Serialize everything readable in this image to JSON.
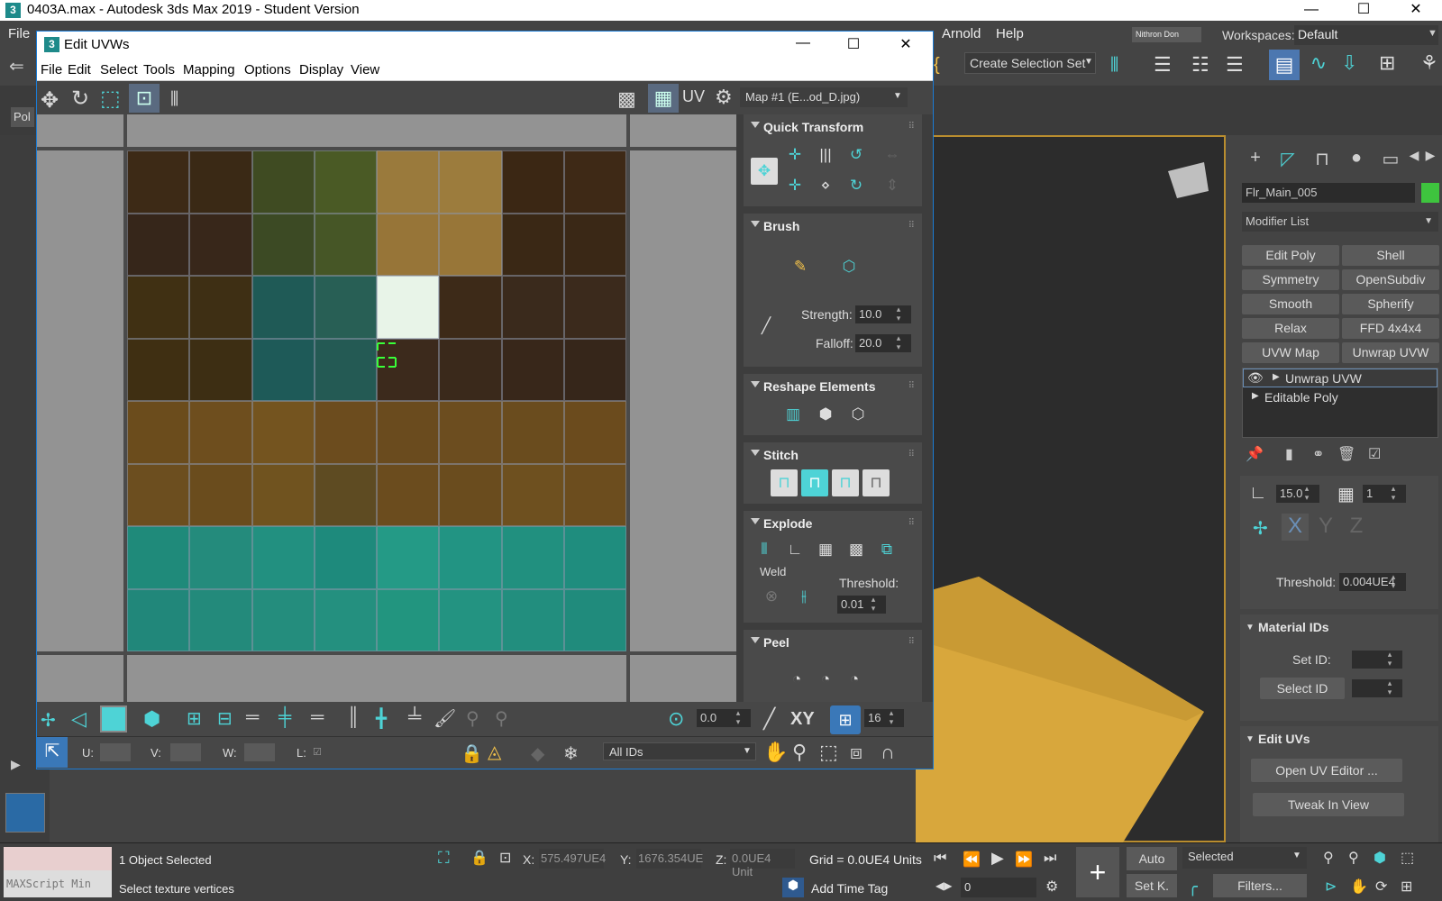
{
  "app": {
    "title": "0403A.max - Autodesk 3ds Max 2019 - Student Version",
    "logo": "3"
  },
  "main_menu": {
    "file": "File",
    "arnold": "Arnold",
    "help": "Help",
    "user": "Nithron Don",
    "workspaces_label": "Workspaces:",
    "workspace_value": "Default",
    "create_selection_set": "Create Selection Set",
    "pol_label": "Pol"
  },
  "uv_window": {
    "title": "Edit UVWs",
    "menu": [
      "File",
      "Edit",
      "Select",
      "Tools",
      "Mapping",
      "Options",
      "Display",
      "View"
    ],
    "uv_label": "UV",
    "map_dropdown": "Map #1 (E...od_D.jpg)",
    "quick_transform": "Quick Transform",
    "brush": "Brush",
    "strength_label": "Strength:",
    "strength_value": "10.0",
    "falloff_label": "Falloff:",
    "falloff_value": "20.0",
    "reshape_elements": "Reshape Elements",
    "stitch": "Stitch",
    "explode": "Explode",
    "weld": "Weld",
    "threshold_label": "Threshold:",
    "threshold_value": "0.01",
    "peel": "Peel",
    "angle_value": "0.0",
    "xy_label": "XY",
    "grid_value": "16",
    "u_label": "U:",
    "v_label": "V:",
    "w_label": "W:",
    "l_label": "L:",
    "ids_dropdown": "All IDs"
  },
  "command_panel": {
    "object_name": "Flr_Main_005",
    "object_color": "#3ec43e",
    "modifier_list": "Modifier List",
    "modifier_buttons": [
      "Edit Poly",
      "Shell",
      "Symmetry",
      "OpenSubdiv",
      "Smooth",
      "Spherify",
      "Relax",
      "FFD 4x4x4",
      "UVW Map",
      "Unwrap UVW"
    ],
    "stack": [
      "Unwrap UVW",
      "Editable Poly"
    ],
    "angle_value": "15.0",
    "count_value": "1",
    "axis_x": "X",
    "axis_y": "Y",
    "axis_z": "Z",
    "threshold_label": "Threshold:",
    "threshold_value": "0.004UE4",
    "material_ids": "Material IDs",
    "set_id": "Set ID:",
    "select_id": "Select ID",
    "edit_uvs": "Edit UVs",
    "open_uv_editor": "Open UV Editor ...",
    "tweak_in_view": "Tweak In View"
  },
  "status": {
    "maxscript": "MAXScript Min",
    "objects_selected": "1 Object Selected",
    "prompt": "Select texture vertices",
    "x_label": "X:",
    "x_value": "575.497UE4",
    "y_label": "Y:",
    "y_value": "1676.354UE",
    "z_label": "Z:",
    "z_value": "0.0UE4 Unit",
    "grid": "Grid = 0.0UE4 Units",
    "add_time_tag": "Add Time Tag",
    "auto": "Auto",
    "set_key": "Set K.",
    "selected": "Selected",
    "filters": "Filters...",
    "frame": "0"
  },
  "texture_grid": {
    "rows": [
      [
        "#3d2a16",
        "#3a2915",
        "#3f4b22",
        "#4a5a25",
        "#9a7a3c",
        "#9c7c3d",
        "#3b2714",
        "#3e2916"
      ],
      [
        "#36261a",
        "#38271a",
        "#3c4a24",
        "#465626",
        "#977538",
        "#987638",
        "#3a2815",
        "#3a2816"
      ],
      [
        "#403013",
        "#3e2f14",
        "#1f5a56",
        "#285f55",
        "#e8f4e8",
        "#3d2a18",
        "#3a2a1c",
        "#3b2a1c"
      ],
      [
        "#3f2f12",
        "#3d2e13",
        "#1e5a58",
        "#245a54",
        "#3c2a1c",
        "#3a291b",
        "#38271a",
        "#36261a"
      ],
      [
        "#6b4c1c",
        "#6e4e1e",
        "#74541f",
        "#6c4c1e",
        "#6a4b1e",
        "#6c4d1f",
        "#6a4c1e",
        "#6b4b1d"
      ],
      [
        "#6c4e1f",
        "#6a4c1d",
        "#70531f",
        "#5e4b22",
        "#6b4c1e",
        "#6a4c1e",
        "#6e501f",
        "#6c4d1e"
      ],
      [
        "#1f8a7a",
        "#248b7c",
        "#229080",
        "#1e8a7c",
        "#249a86",
        "#229483",
        "#21907f",
        "#1f8d7e"
      ],
      [
        "#21877a",
        "#238a7b",
        "#248d7d",
        "#24907f",
        "#22957f",
        "#239381",
        "#228e7e",
        "#208b7c"
      ]
    ]
  }
}
